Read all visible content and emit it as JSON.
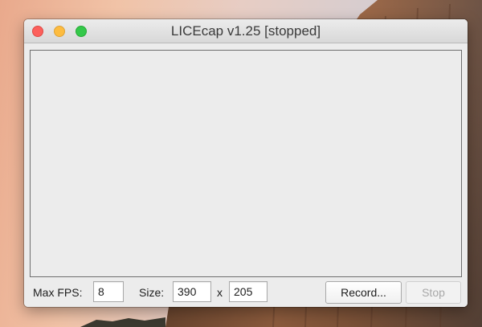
{
  "window": {
    "title": "LICEcap v1.25 [stopped]",
    "buttons": {
      "close_color": "#fc605c",
      "minimize_color": "#fdbc40",
      "maximize_color": "#34c84a"
    }
  },
  "controls": {
    "max_fps_label": "Max FPS:",
    "max_fps_value": "8",
    "size_label": "Size:",
    "width_value": "390",
    "size_separator": "x",
    "height_value": "205",
    "record_label": "Record...",
    "stop_label": "Stop",
    "stop_enabled": false
  },
  "colors": {
    "window_bg": "#ececec",
    "frame_border": "#6e6e6e"
  }
}
